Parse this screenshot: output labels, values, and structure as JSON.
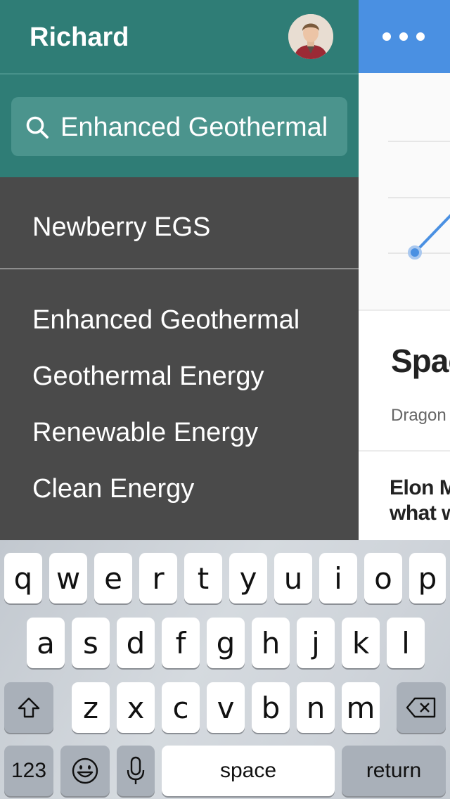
{
  "main": {
    "article1_title": "Spac",
    "article1_subtitle": "Dragon",
    "article2_title_lines": [
      "Elon M",
      "what w"
    ],
    "accent_color": "#4A90E2"
  },
  "drawer": {
    "user_name": "Richard",
    "header_color": "#2F7D76",
    "search": {
      "value": "Enhanced Geothermal",
      "icon": "search-icon"
    },
    "top_result": "Newberry EGS",
    "suggestions": [
      "Enhanced Geothermal",
      "Geothermal Energy",
      "Renewable Energy",
      "Clean Energy"
    ]
  },
  "keyboard": {
    "row1": [
      "q",
      "w",
      "e",
      "r",
      "t",
      "y",
      "u",
      "i",
      "o",
      "p"
    ],
    "row2": [
      "a",
      "s",
      "d",
      "f",
      "g",
      "h",
      "j",
      "k",
      "l"
    ],
    "row3": [
      "z",
      "x",
      "c",
      "v",
      "b",
      "n",
      "m"
    ],
    "numbers_label": "123",
    "space_label": "space",
    "return_label": "return",
    "shift_icon": "shift-icon",
    "delete_icon": "delete-icon",
    "emoji_icon": "emoji-icon",
    "mic_icon": "microphone-icon"
  }
}
